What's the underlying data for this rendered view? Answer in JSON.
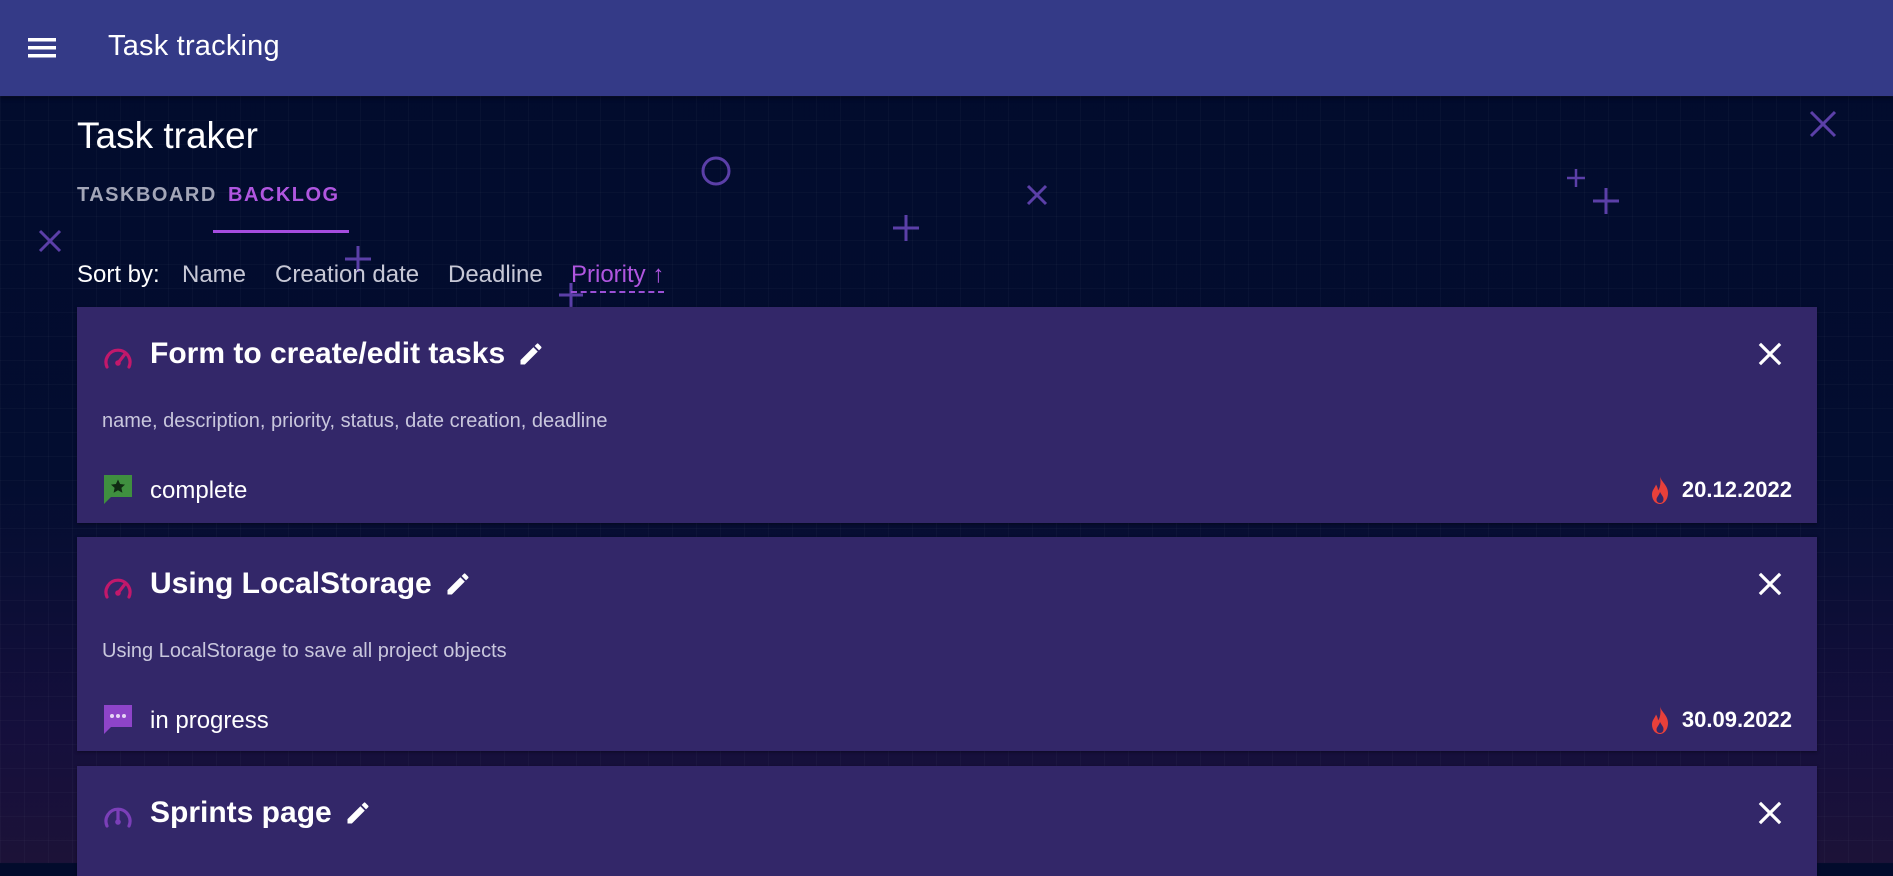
{
  "app": {
    "title": "Task tracking"
  },
  "page": {
    "title": "Task traker"
  },
  "tabs": [
    {
      "label": "TASKBOARD",
      "active": false
    },
    {
      "label": "BACKLOG",
      "active": true
    }
  ],
  "sort": {
    "label": "Sort by:",
    "options": [
      "Name",
      "Creation date",
      "Deadline",
      "Priority ↑"
    ],
    "active": "Priority ↑"
  },
  "tasks": [
    {
      "title": "Form to create/edit tasks",
      "description": "name, description, priority, status, date creation, deadline",
      "status": "complete",
      "status_icon": "message-star-icon",
      "priority_icon": "speedometer-icon",
      "deadline": "20.12.2022"
    },
    {
      "title": "Using LocalStorage",
      "description": "Using LocalStorage to save all project objects",
      "status": "in progress",
      "status_icon": "message-dots-icon",
      "priority_icon": "speedometer-icon",
      "deadline": "30.09.2022"
    },
    {
      "title": "Sprints page",
      "priority_icon": "speedometer-low-icon"
    }
  ],
  "colors": {
    "appbar": "#343a87",
    "background": "#020b2c",
    "card": "#332769",
    "accent": "#b056e0",
    "priority_high": "#c2186b",
    "priority_low": "#7b3fb8",
    "status_complete": "#3f8f3f",
    "status_in_progress": "#8e44c9",
    "deadline_fire": "#e8403a"
  }
}
